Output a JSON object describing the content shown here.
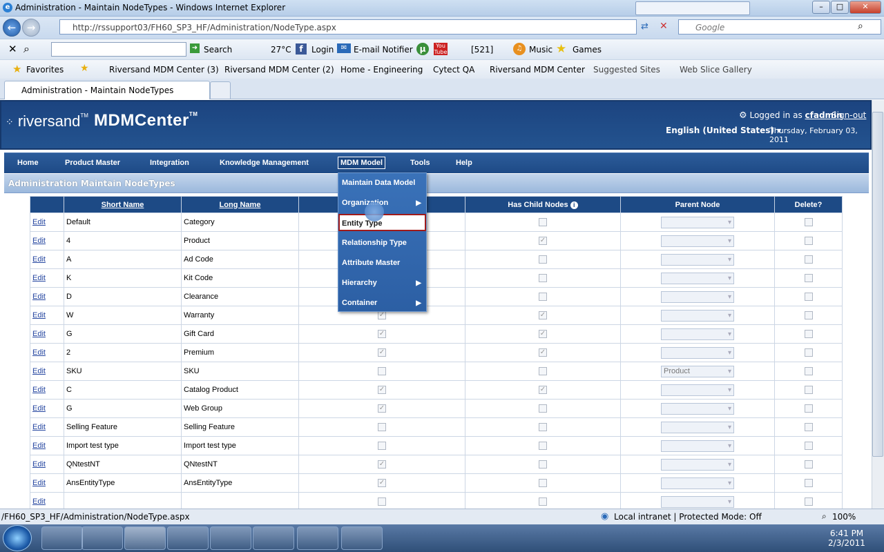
{
  "window": {
    "title": "Administration - Maintain NodeTypes - Windows Internet Explorer",
    "min_label": "–",
    "max_label": "□",
    "close_label": "✕"
  },
  "browser": {
    "url": "http://rssupport03/FH60_SP3_HF/Administration/NodeType.aspx",
    "search_placeholder": "Google",
    "toolbar": {
      "search_label": "Search",
      "weather": "27°C",
      "login": "Login",
      "email": "E-mail Notifier",
      "counter": "[521]",
      "music": "Music",
      "games": "Games"
    },
    "favorites": {
      "label": "Favorites",
      "items": [
        "Riversand MDM Center (3)",
        "Riversand MDM Center (2)",
        "Home - Engineering",
        "Cytect QA",
        "Riversand MDM Center",
        "Suggested Sites",
        "Web Slice Gallery"
      ]
    },
    "tab_title": "Administration - Maintain NodeTypes"
  },
  "app": {
    "logo_left": "riversand",
    "logo_right": "MDMCenter",
    "tm": "TM",
    "logged_in_prefix": "Logged in as ",
    "user": "cfadmin",
    "sign_out": "Sign-out",
    "language": "English (United States)",
    "date": "Thursday, February 03, 2011",
    "nav": [
      "Home",
      "Product Master",
      "Integration",
      "Knowledge Management",
      "MDM Model",
      "Tools",
      "Help"
    ],
    "page_title": "Administration Maintain NodeTypes"
  },
  "menu": {
    "items": [
      "Maintain Data Model",
      "Organization",
      "Entity Type",
      "Relationship Type",
      "Attribute Master",
      "Hierarchy",
      "Container"
    ]
  },
  "grid": {
    "headers": [
      "Short Name",
      "Long Name",
      "Has Child Nodes",
      "Parent Node",
      "Delete?"
    ],
    "edit_label": "Edit",
    "rows": [
      {
        "short": "Default",
        "long": "Category",
        "c1": false,
        "child": false,
        "parent": ""
      },
      {
        "short": "4",
        "long": "Product",
        "c1": false,
        "child": true,
        "parent": ""
      },
      {
        "short": "A",
        "long": "Ad Code",
        "c1": false,
        "child": false,
        "parent": ""
      },
      {
        "short": "K",
        "long": "Kit Code",
        "c1": false,
        "child": false,
        "parent": ""
      },
      {
        "short": "D",
        "long": "Clearance",
        "c1": false,
        "child": false,
        "parent": ""
      },
      {
        "short": "W",
        "long": "Warranty",
        "c1": true,
        "child": true,
        "parent": ""
      },
      {
        "short": "G",
        "long": "Gift Card",
        "c1": true,
        "child": true,
        "parent": ""
      },
      {
        "short": "2",
        "long": "Premium",
        "c1": true,
        "child": true,
        "parent": ""
      },
      {
        "short": "SKU",
        "long": "SKU",
        "c1": false,
        "child": false,
        "parent": "Product"
      },
      {
        "short": "C",
        "long": "Catalog Product",
        "c1": true,
        "child": true,
        "parent": ""
      },
      {
        "short": "G",
        "long": "Web Group",
        "c1": true,
        "child": false,
        "parent": ""
      },
      {
        "short": "Selling Feature",
        "long": "Selling Feature",
        "c1": false,
        "child": false,
        "parent": ""
      },
      {
        "short": "Import test type",
        "long": "Import test type",
        "c1": false,
        "child": false,
        "parent": ""
      },
      {
        "short": "QNtestNT",
        "long": "QNtestNT",
        "c1": true,
        "child": false,
        "parent": ""
      },
      {
        "short": "AnsEntityType",
        "long": "AnsEntityType",
        "c1": true,
        "child": false,
        "parent": ""
      },
      {
        "short": "",
        "long": "",
        "c1": false,
        "child": false,
        "parent": ""
      }
    ]
  },
  "status": {
    "url": "/FH60_SP3_HF/Administration/NodeType.aspx",
    "zone": "Local intranet | Protected Mode: Off",
    "zoom": "100%"
  },
  "taskbar": {
    "time": "6:41 PM",
    "date": "2/3/2011"
  },
  "colors": {
    "header_blue": "#1c4480",
    "menu_blue": "#2c5fa4",
    "link_blue": "#2546a0",
    "highlight_border": "#a01a1a"
  }
}
